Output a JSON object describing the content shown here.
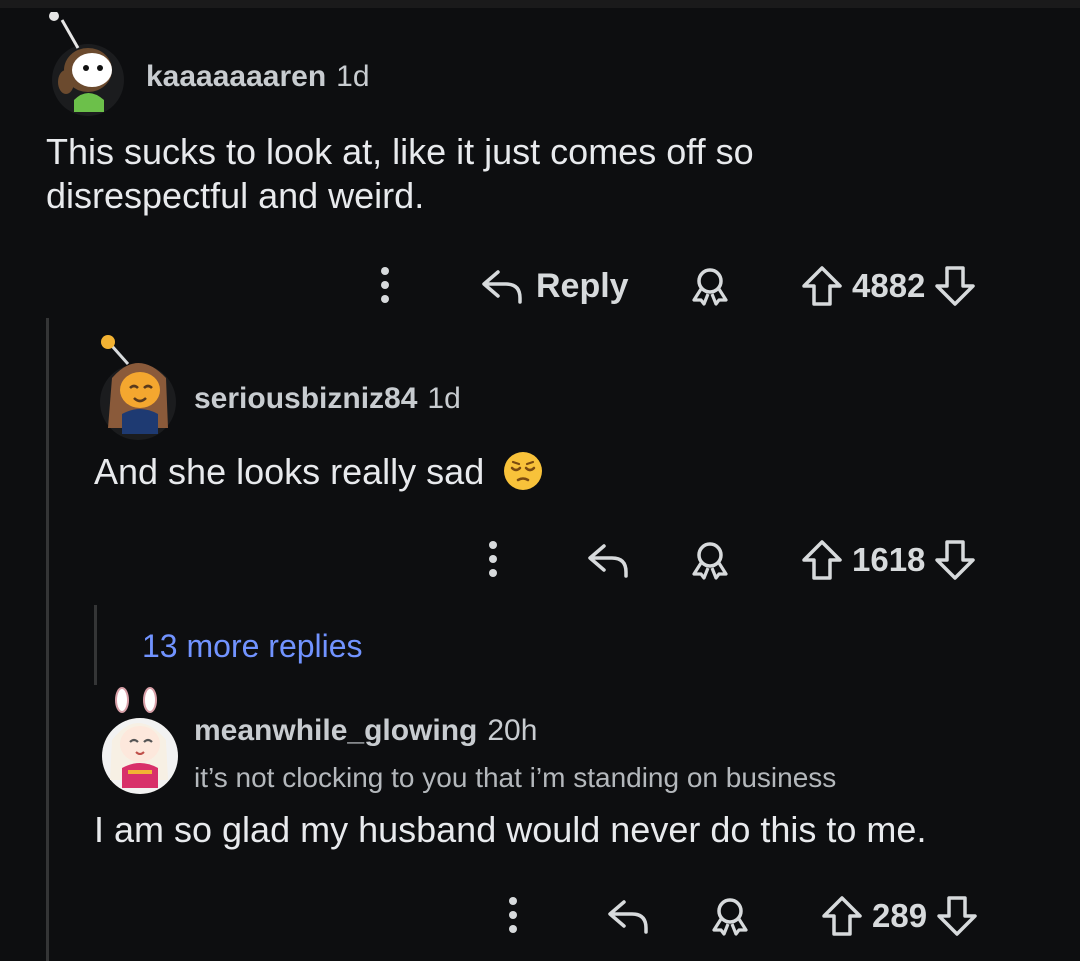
{
  "comments": [
    {
      "username": "kaaaaaaaren",
      "age": "1d",
      "body_lines": [
        "This sucks to look at, like it just comes off so",
        "disrespectful and weird."
      ],
      "reply_label": "Reply",
      "score": "4882"
    },
    {
      "username": "seriousbizniz84",
      "age": "1d",
      "body": "And she looks really sad",
      "emoji": "pensive-face",
      "score": "1618"
    },
    {
      "username": "meanwhile_glowing",
      "age": "20h",
      "flair": "it’s not clocking to you that i’m standing on business",
      "body": "I am so glad my husband would never do this to me.",
      "score": "289"
    }
  ],
  "more_replies": "13 more replies",
  "colors": {
    "background": "#0d0e10",
    "text": "#d7dadc",
    "link": "#7193ff",
    "thread_line": "#343536"
  },
  "icons": [
    "more-options-icon",
    "reply-icon",
    "award-icon",
    "upvote-icon",
    "downvote-icon"
  ]
}
